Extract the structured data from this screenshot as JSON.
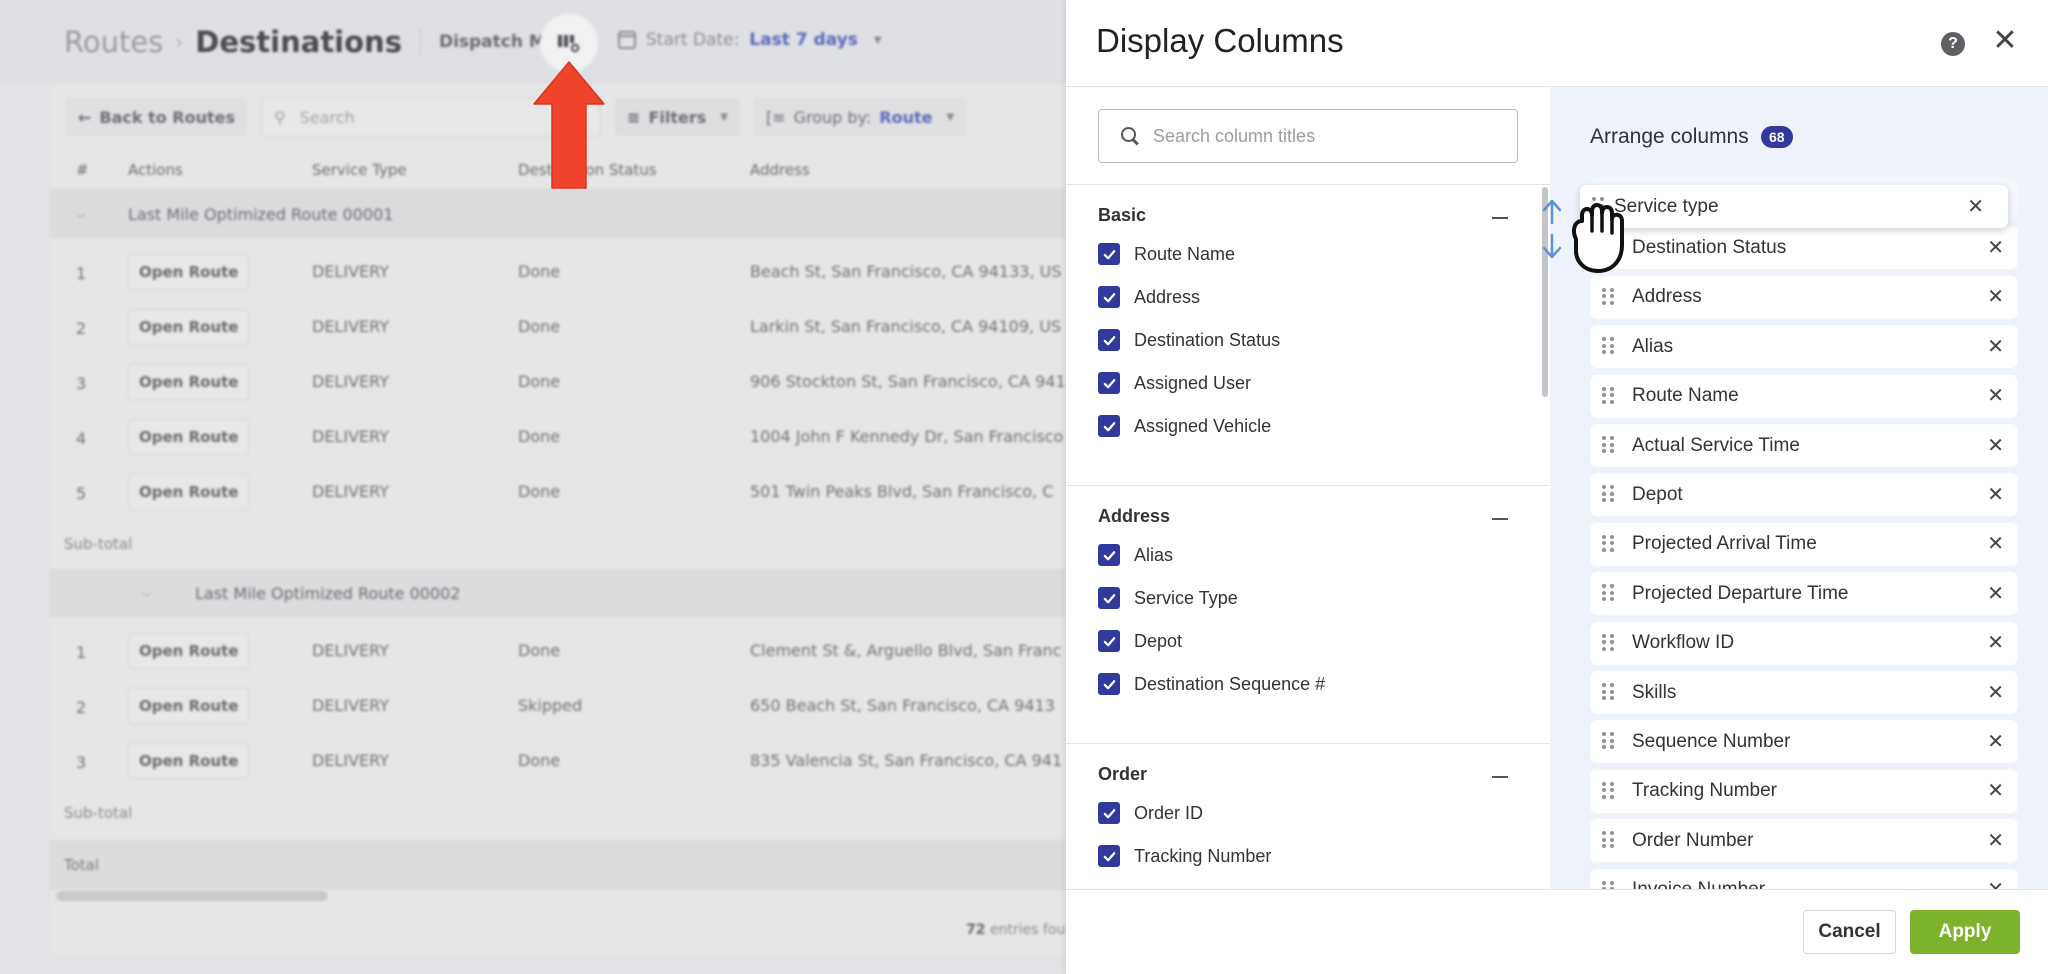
{
  "background": {
    "breadcrumb": {
      "parent": "Routes",
      "current": "Destinations"
    },
    "dispatch_mode": "Dispatch Mode",
    "start_date_label": "Start Date:",
    "start_date_value": "Last 7 days",
    "toolbar": {
      "back_label": "Back to Routes",
      "search_placeholder": "Search",
      "filters_label": "Filters",
      "group_by_label": "Group by:",
      "group_by_value": "Route"
    },
    "table": {
      "columns": [
        "#",
        "Actions",
        "Service Type",
        "Destination Status",
        "Address"
      ],
      "groups": [
        {
          "title": "Last Mile Optimized Route 00001",
          "rows": [
            {
              "num": "1",
              "action": "Open Route",
              "service": "DELIVERY",
              "status": "Done",
              "address": "Beach St, San Francisco, CA 94133, US"
            },
            {
              "num": "2",
              "action": "Open Route",
              "service": "DELIVERY",
              "status": "Done",
              "address": "Larkin St, San Francisco, CA 94109, US"
            },
            {
              "num": "3",
              "action": "Open Route",
              "service": "DELIVERY",
              "status": "Done",
              "address": "906 Stockton St, San Francisco, CA 941"
            },
            {
              "num": "4",
              "action": "Open Route",
              "service": "DELIVERY",
              "status": "Done",
              "address": "1004 John F Kennedy Dr, San Francisco"
            },
            {
              "num": "5",
              "action": "Open Route",
              "service": "DELIVERY",
              "status": "Done",
              "address": "501 Twin Peaks Blvd, San Francisco, C"
            }
          ],
          "subtotal_label": "Sub-total"
        },
        {
          "title": "Last Mile Optimized Route 00002",
          "rows": [
            {
              "num": "1",
              "action": "Open Route",
              "service": "DELIVERY",
              "status": "Done",
              "address": "Clement St &, Arguello Blvd, San Franc"
            },
            {
              "num": "2",
              "action": "Open Route",
              "service": "DELIVERY",
              "status": "Skipped",
              "address": "650 Beach St, San Francisco, CA 9413"
            },
            {
              "num": "3",
              "action": "Open Route",
              "service": "DELIVERY",
              "status": "Done",
              "address": "835 Valencia St, San Francisco, CA 941"
            }
          ],
          "subtotal_label": "Sub-total"
        }
      ],
      "total_label": "Total",
      "entries_count": "72",
      "entries_suffix": "entries fou"
    }
  },
  "drawer": {
    "title": "Display Columns",
    "search_placeholder": "Search column titles",
    "sections": [
      {
        "title": "Basic",
        "items": [
          "Route Name",
          "Address",
          "Destination Status",
          "Assigned User",
          "Assigned Vehicle"
        ]
      },
      {
        "title": "Address",
        "items": [
          "Alias",
          "Service Type",
          "Depot",
          "Destination Sequence #"
        ]
      },
      {
        "title": "Order",
        "items": [
          "Order ID",
          "Tracking Number"
        ]
      }
    ],
    "arrange": {
      "title": "Arrange columns",
      "count": "68",
      "dragging_item": "Service type",
      "items": [
        "Service type",
        "Destination Status",
        "Address",
        "Alias",
        "Route Name",
        "Actual Service Time",
        "Depot",
        "Projected Arrival Time",
        "Projected Departure Time",
        "Workflow ID",
        "Skills",
        "Sequence Number",
        "Tracking Number",
        "Order Number",
        "Invoice Number"
      ]
    },
    "cancel_label": "Cancel",
    "apply_label": "Apply"
  },
  "colors": {
    "accent": "#2f3a9c",
    "apply": "#7cb32a",
    "highlight_arrow": "#f0442c",
    "link": "#5b67b8"
  }
}
